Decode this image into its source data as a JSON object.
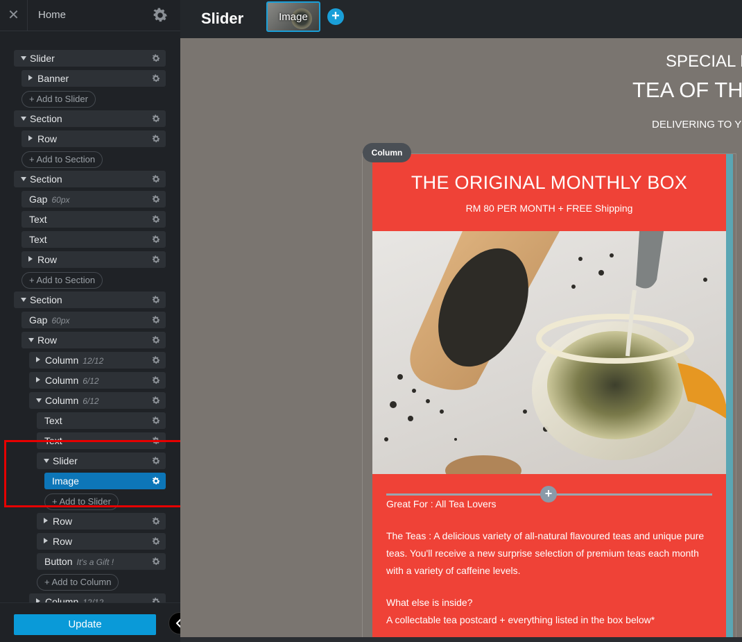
{
  "sidebar": {
    "close_icon": "✕",
    "home_label": "Home",
    "tree": [
      {
        "label": "Slider",
        "arrow": "down",
        "meta": ""
      },
      {
        "label": "Banner",
        "arrow": "right",
        "meta": ""
      },
      {
        "add": "+ Add to Slider"
      },
      {
        "label": "Section",
        "arrow": "down",
        "meta": ""
      },
      {
        "label": "Row",
        "arrow": "right",
        "meta": ""
      },
      {
        "add": "+ Add to Section"
      },
      {
        "label": "Section",
        "arrow": "down",
        "meta": ""
      },
      {
        "label": "Gap",
        "arrow": "",
        "meta": "60px"
      },
      {
        "label": "Text",
        "arrow": "",
        "meta": ""
      },
      {
        "label": "Text",
        "arrow": "",
        "meta": ""
      },
      {
        "label": "Row",
        "arrow": "right",
        "meta": ""
      },
      {
        "add": "+ Add to Section"
      },
      {
        "label": "Section",
        "arrow": "down",
        "meta": ""
      },
      {
        "label": "Gap",
        "arrow": "",
        "meta": "60px"
      },
      {
        "label": "Row",
        "arrow": "down",
        "meta": ""
      },
      {
        "label": "Column",
        "arrow": "right",
        "meta": "12/12"
      },
      {
        "label": "Column",
        "arrow": "right",
        "meta": "6/12"
      },
      {
        "label": "Column",
        "arrow": "down",
        "meta": "6/12"
      },
      {
        "label": "Text",
        "arrow": "",
        "meta": ""
      },
      {
        "label": "Text",
        "arrow": "",
        "meta": ""
      },
      {
        "label": "Slider",
        "arrow": "down",
        "meta": ""
      },
      {
        "label": "Image",
        "arrow": "",
        "meta": "",
        "active": true
      },
      {
        "add": "+ Add to Slider"
      },
      {
        "label": "Row",
        "arrow": "right",
        "meta": ""
      },
      {
        "label": "Row",
        "arrow": "right",
        "meta": ""
      },
      {
        "label": "Button",
        "arrow": "",
        "meta": "It's a Gift !"
      },
      {
        "add": "+ Add to Column"
      },
      {
        "label": "Column",
        "arrow": "right",
        "meta": "12/12"
      }
    ],
    "update_label": "Update"
  },
  "topbar": {
    "title": "Slider",
    "thumb_label": "Image",
    "add_label": "+"
  },
  "canvas": {
    "heading1": "SPECIAL PA",
    "heading2": "TEA OF TH",
    "heading3": "DELIVERING TO YO",
    "column_badge": "Column",
    "box_title": "THE ORIGINAL MONTHLY BOX",
    "box_subtitle": "RM 80 PER MONTH + FREE Shipping",
    "paragraph1": "Great For :  All Tea Lovers",
    "paragraph2": "The Teas : A delicious variety of all-natural flavoured teas and unique pure teas. You'll receive a new surprise selection of premium teas each month with a variety of caffeine levels.",
    "paragraph3": "What else is inside?",
    "paragraph4": "A collectable tea postcard + everything listed in the box below*"
  },
  "colors": {
    "accent": "#0a9ad8",
    "active_item": "#0d76b8",
    "box_red": "#ef4237",
    "highlight": "#e60000"
  }
}
